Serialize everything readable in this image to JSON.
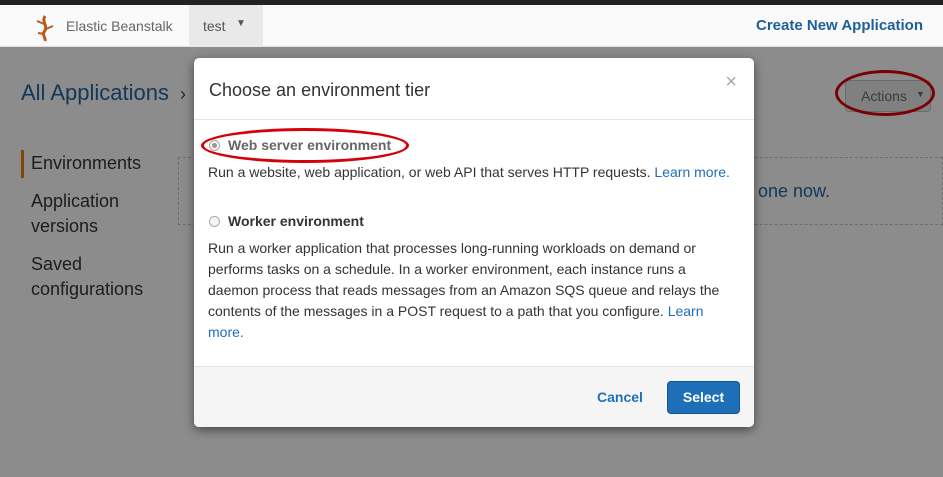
{
  "header": {
    "brand": "Elastic Beanstalk",
    "app_selector": "test",
    "create_link": "Create New Application"
  },
  "breadcrumb": {
    "all_apps": "All Applications",
    "separator": "›"
  },
  "actions_button": "Actions",
  "sidebar": {
    "items": [
      {
        "label": "Environments"
      },
      {
        "label": "Application versions"
      },
      {
        "label": "Saved configurations"
      }
    ]
  },
  "main": {
    "partial_text": "one now."
  },
  "modal": {
    "title": "Choose an environment tier",
    "close": "×",
    "options": [
      {
        "label": "Web server environment",
        "description": "Run a website, web application, or web API that serves HTTP requests.",
        "link": "Learn more.",
        "selected": true
      },
      {
        "label": "Worker environment",
        "description": "Run a worker application that processes long-running workloads on demand or performs tasks on a schedule. In a worker environment, each instance runs a daemon process that reads messages from an Amazon SQS queue and relays the contents of the messages in a POST request to a path that you configure.",
        "link": "Learn more.",
        "selected": false
      }
    ],
    "cancel": "Cancel",
    "select": "Select"
  },
  "colors": {
    "accent": "#1f6fb8",
    "highlight_circle": "#d4000a",
    "active_bar": "#e07b00"
  }
}
